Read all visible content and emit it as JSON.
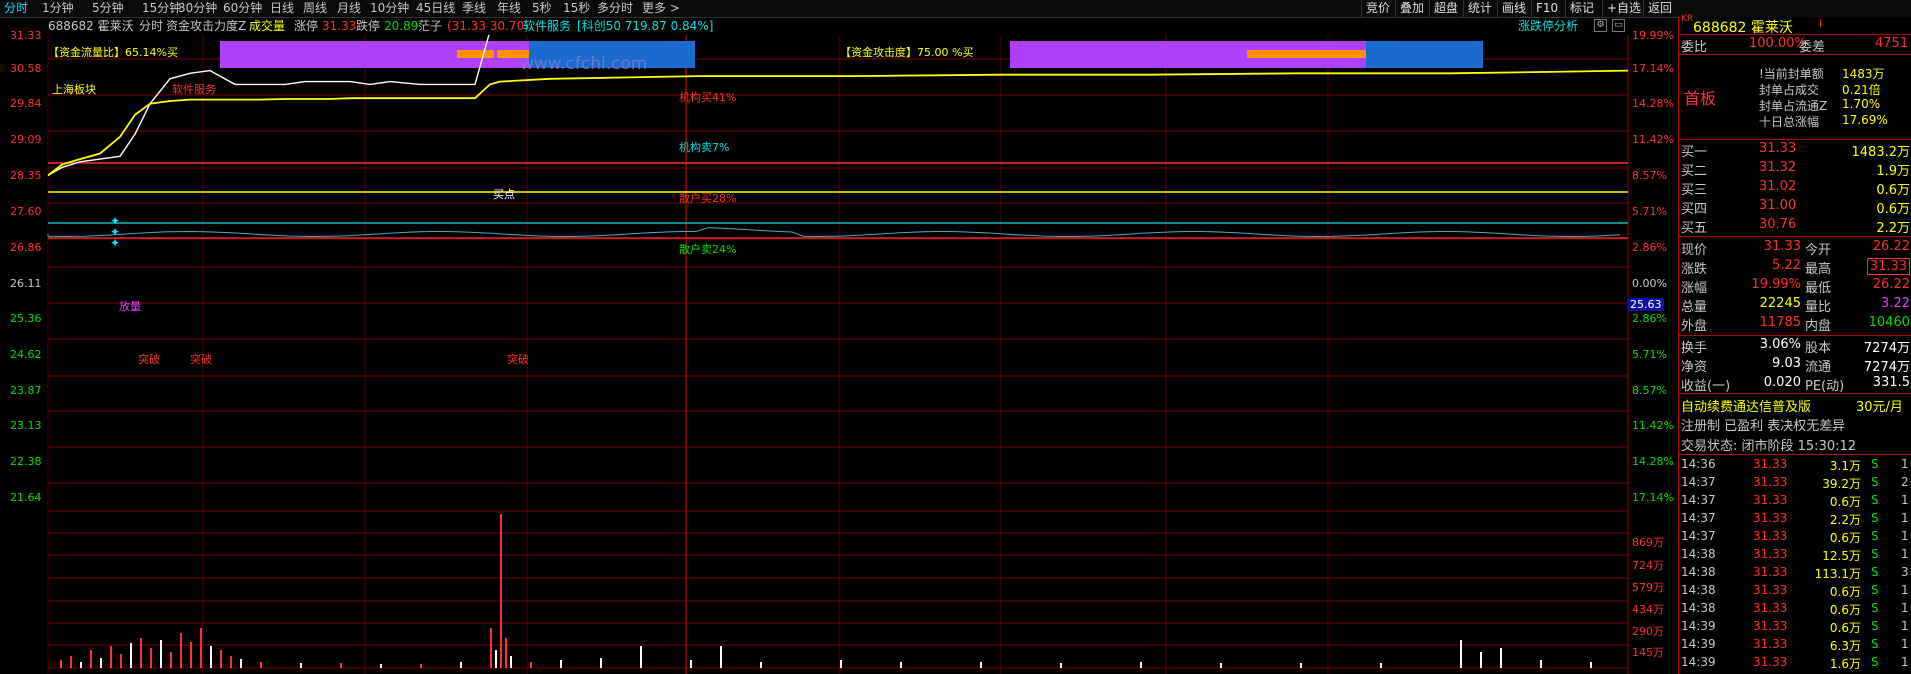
{
  "toolbar": {
    "tabs": [
      "分时",
      "1分钟",
      "5分钟",
      "15分钟",
      "30分钟",
      "60分钟",
      "日线",
      "周线",
      "月线",
      "10分钟",
      "45日线",
      "季线",
      "年线",
      "5秒",
      "15秒",
      "多分时",
      "更多 >"
    ],
    "right_items": [
      "竞价",
      "叠加",
      "超盘",
      "统计",
      "画线",
      "F10",
      "标记",
      "+自选",
      "返回"
    ]
  },
  "infobar": {
    "code_name": "688682 霍莱沃",
    "mode": "分时",
    "indicator": "资金攻击力度Z",
    "volume_label": "成交量",
    "limit_up_label": "涨停",
    "limit_up_value": "31.33",
    "limit_down_label": "跌停",
    "limit_down_value": "20.89",
    "flow_label": "茫子",
    "flow_value": "(31.33 30.70)",
    "sector": "软件服务",
    "board": "[科创50 719.87 0.84%]",
    "analysis_link": "涨跌停分析"
  },
  "chart_text": {
    "flow_ratio": "【资金流量比】65.14%买",
    "attack_degree": "【资金攻击度】75.00 %买",
    "watermark": "www.cfchi.com",
    "sh_sector": "上海板块",
    "sector_tag": "软件服务",
    "inst_buy": "机构买41%",
    "inst_sell": "机构卖7%",
    "retail_buy": "散户买28%",
    "retail_sell": "散户卖24%",
    "buy_point": "买点",
    "volume_up": "放量",
    "breakout_1": "突破",
    "breakout_2": "突破",
    "breakout_3": "突破",
    "avg_label": "25.63"
  },
  "price_axis": [
    "31.33",
    "30.58",
    "29.84",
    "29.09",
    "28.35",
    "27.60",
    "26.86",
    "26.11",
    "25.36",
    "24.62",
    "23.87",
    "23.13",
    "22.38",
    "21.64"
  ],
  "pct_axis": [
    "19.99%",
    "17.14%",
    "14.28%",
    "11.42%",
    "8.57%",
    "5.71%",
    "2.86%",
    "0.00%",
    "2.86%",
    "5.71%",
    "8.57%",
    "11.42%",
    "14.28%",
    "17.14%"
  ],
  "vol_axis": [
    "869万",
    "724万",
    "579万",
    "434万",
    "290万",
    "145万"
  ],
  "colors": {
    "up": "#ff3030",
    "down": "#00e000",
    "yellow": "#ffff00",
    "cyan": "#00e0e0",
    "magenta": "#e040ff",
    "white": "#ffffff",
    "grid": "#8b0000"
  },
  "chart_data": {
    "type": "line",
    "ylim": [
      21.64,
      31.33
    ],
    "series": [
      {
        "values": [
          26.11,
          26.4,
          26.6,
          26.7,
          26.8,
          27.6,
          28.7,
          29.6,
          29.8,
          29.9,
          29.4,
          29.4,
          29.4,
          29.5,
          29.5,
          29.5,
          29.4,
          29.5,
          29.4,
          29.4,
          31.33,
          31.33,
          31.33,
          31.33,
          31.33,
          31.33,
          31.33,
          31.33,
          31.33,
          31.33,
          31.33
        ]
      },
      {
        "values": [
          26.11,
          26.5,
          26.7,
          26.9,
          27.5,
          28.3,
          28.7,
          28.8,
          28.85,
          28.85,
          28.85,
          28.85,
          28.87,
          28.87,
          28.87,
          28.9,
          28.9,
          28.9,
          28.9,
          28.9,
          29.4,
          29.5,
          29.6,
          29.7,
          29.7,
          29.75,
          29.75,
          29.8,
          29.8,
          29.85,
          29.9
        ]
      }
    ]
  },
  "quote": {
    "header_code": "688682 霍莱沃",
    "header_badge": "KR",
    "wb_label": "委比",
    "wb_value": "100.00%",
    "wc_label": "委差",
    "wc_value": "4751",
    "first_board": "首板",
    "seal_rows": [
      {
        "label": "!当前封单额",
        "value": "1483万"
      },
      {
        "label": "封单占成交",
        "value": "0.21倍"
      },
      {
        "label": "封单占流通Z",
        "value": "1.70%"
      },
      {
        "label": "十日总涨幅",
        "value": "17.69%"
      }
    ],
    "bids": [
      {
        "label": "买一",
        "price": "31.33",
        "vol": "1483.2万"
      },
      {
        "label": "买二",
        "price": "31.32",
        "vol": "1.9万"
      },
      {
        "label": "买三",
        "price": "31.02",
        "vol": "0.6万"
      },
      {
        "label": "买四",
        "price": "31.00",
        "vol": "0.6万"
      },
      {
        "label": "买五",
        "price": "30.76",
        "vol": "2.2万"
      }
    ],
    "stats": [
      {
        "l1": "现价",
        "v1": "31.33",
        "l2": "今开",
        "v2": "26.22"
      },
      {
        "l1": "涨跌",
        "v1": "5.22",
        "l2": "最高",
        "v2": "31.33"
      },
      {
        "l1": "涨幅",
        "v1": "19.99%",
        "l2": "最低",
        "v2": "26.22"
      },
      {
        "l1": "总量",
        "v1": "22245",
        "l2": "量比",
        "v2": "3.22"
      },
      {
        "l1": "外盘",
        "v1": "11785",
        "l2": "内盘",
        "v2": "10460"
      }
    ],
    "fund": [
      {
        "l1": "换手",
        "v1": "3.06%",
        "l2": "股本",
        "v2": "7274万"
      },
      {
        "l1": "净资",
        "v1": "9.03",
        "l2": "流通",
        "v2": "7274万"
      },
      {
        "l1": "收益(一)",
        "v1": "0.020",
        "l2": "PE(动)",
        "v2": "331.5"
      }
    ],
    "promo": "自动续费通达信普及版",
    "promo_price": "30元/月",
    "reg": "注册制 已盈利 表决权无差异",
    "trade_status": "交易状态: 闭市阶段 15:30:12",
    "ticks": [
      {
        "t": "14:36",
        "p": "31.33",
        "v": "3.1万",
        "s": "S",
        "n": "1"
      },
      {
        "t": "14:37",
        "p": "31.33",
        "v": "39.2万",
        "s": "S",
        "n": "2"
      },
      {
        "t": "14:37",
        "p": "31.33",
        "v": "0.6万",
        "s": "S",
        "n": "1"
      },
      {
        "t": "14:37",
        "p": "31.33",
        "v": "2.2万",
        "s": "S",
        "n": "1"
      },
      {
        "t": "14:37",
        "p": "31.33",
        "v": "0.6万",
        "s": "S",
        "n": "1"
      },
      {
        "t": "14:38",
        "p": "31.33",
        "v": "12.5万",
        "s": "S",
        "n": "1"
      },
      {
        "t": "14:38",
        "p": "31.33",
        "v": "113.1万",
        "s": "S",
        "n": "3"
      },
      {
        "t": "14:38",
        "p": "31.33",
        "v": "0.6万",
        "s": "S",
        "n": "1"
      },
      {
        "t": "14:38",
        "p": "31.33",
        "v": "0.6万",
        "s": "S",
        "n": "1"
      },
      {
        "t": "14:39",
        "p": "31.33",
        "v": "0.6万",
        "s": "S",
        "n": "1"
      },
      {
        "t": "14:39",
        "p": "31.33",
        "v": "6.3万",
        "s": "S",
        "n": "1"
      },
      {
        "t": "14:39",
        "p": "31.33",
        "v": "1.6万",
        "s": "S",
        "n": "1"
      }
    ]
  }
}
